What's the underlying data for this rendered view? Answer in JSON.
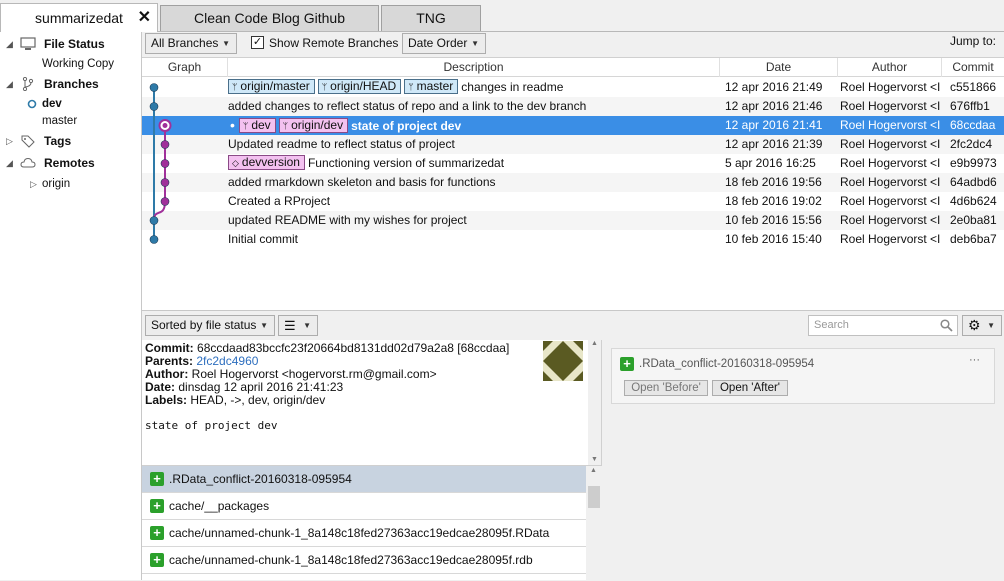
{
  "tabs": [
    {
      "label": "summarizedat",
      "close": "✕"
    },
    {
      "label": "Clean Code Blog Github"
    },
    {
      "label": "TNG"
    }
  ],
  "sidebar": {
    "file_status": "File Status",
    "working_copy": "Working Copy",
    "branches": "Branches",
    "branch_items": [
      "dev",
      "master"
    ],
    "tags": "Tags",
    "remotes": "Remotes",
    "remote_items": [
      "origin"
    ]
  },
  "toolbar": {
    "branches_filter": "All Branches",
    "show_remote": "Show Remote Branches",
    "order": "Date Order",
    "jump_to": "Jump to:"
  },
  "columns": [
    "Graph",
    "Description",
    "Date",
    "Author",
    "Commit"
  ],
  "commits": [
    {
      "labels": [
        {
          "text": "origin/master",
          "color": "blue"
        },
        {
          "text": "origin/HEAD",
          "color": "blue"
        },
        {
          "text": "master",
          "color": "blue"
        }
      ],
      "description": "changes in readme",
      "date": "12 apr 2016 21:49",
      "author": "Roel Hogervorst <I",
      "hash": "c551866"
    },
    {
      "labels": [],
      "description": "added changes to reflect status of repo and a link to the dev branch",
      "date": "12 apr 2016 21:46",
      "author": "Roel Hogervorst <I",
      "hash": "676ffb1"
    },
    {
      "labels": [
        {
          "text": "dev",
          "color": "pink"
        },
        {
          "text": "origin/dev",
          "color": "pink"
        }
      ],
      "head": true,
      "description": "state of project dev",
      "date": "12 apr 2016 21:41",
      "author": "Roel Hogervorst <I",
      "hash": "68ccdaa",
      "selected": true
    },
    {
      "labels": [],
      "description": "Updated readme to reflect status of project",
      "date": "12 apr 2016 21:39",
      "author": "Roel Hogervorst <I",
      "hash": "2fc2dc4"
    },
    {
      "labels": [
        {
          "text": "devversion",
          "color": "pink",
          "tag": true
        }
      ],
      "description": "Functioning version of summarizedat",
      "date": "5 apr 2016 16:25",
      "author": "Roel Hogervorst <I",
      "hash": "e9b9973"
    },
    {
      "labels": [],
      "description": "added rmarkdown skeleton and basis for functions",
      "date": "18 feb 2016 19:56",
      "author": "Roel Hogervorst <I",
      "hash": "64adbd6"
    },
    {
      "labels": [],
      "description": "Created a RProject",
      "date": "18 feb 2016 19:02",
      "author": "Roel Hogervorst <I",
      "hash": "4d6b624"
    },
    {
      "labels": [],
      "description": "updated README with my wishes for project",
      "date": "10 feb 2016 15:56",
      "author": "Roel Hogervorst <I",
      "hash": "2e0ba81"
    },
    {
      "labels": [],
      "description": "Initial commit",
      "date": "10 feb 2016 15:40",
      "author": "Roel Hogervorst <I",
      "hash": "deb6ba7"
    }
  ],
  "lower": {
    "sort": "Sorted by file status",
    "search_placeholder": "Search"
  },
  "details": {
    "commit_label": "Commit:",
    "commit_value": "68ccdaad83bccfc23f20664bd8131dd02d79a2a8 [68ccdaa]",
    "parents_label": "Parents:",
    "parents_value": "2fc2dc4960",
    "author_label": "Author:",
    "author_value": "Roel Hogervorst <hogervorst.rm@gmail.com>",
    "date_label": "Date:",
    "date_value": "dinsdag 12 april 2016 21:41:23",
    "labels_label": "Labels:",
    "labels_value": "HEAD, ->, dev, origin/dev",
    "message": "state of project dev"
  },
  "files": [
    ".RData_conflict-20160318-095954",
    "cache/__packages",
    "cache/unnamed-chunk-1_8a148c18fed27363acc19edcae28095f.RData",
    "cache/unnamed-chunk-1_8a148c18fed27363acc19edcae28095f.rdb"
  ],
  "diff": {
    "file": ".RData_conflict-20160318-095954",
    "more": "···",
    "open_before": "Open 'Before'",
    "open_after": "Open 'After'"
  },
  "colors": {
    "selection": "#3a8ee6",
    "branch_blue": "#2e7aa8",
    "branch_purple": "#a0309a",
    "label_blue": "#cfe8f8",
    "label_pink": "#f3c1f0"
  }
}
